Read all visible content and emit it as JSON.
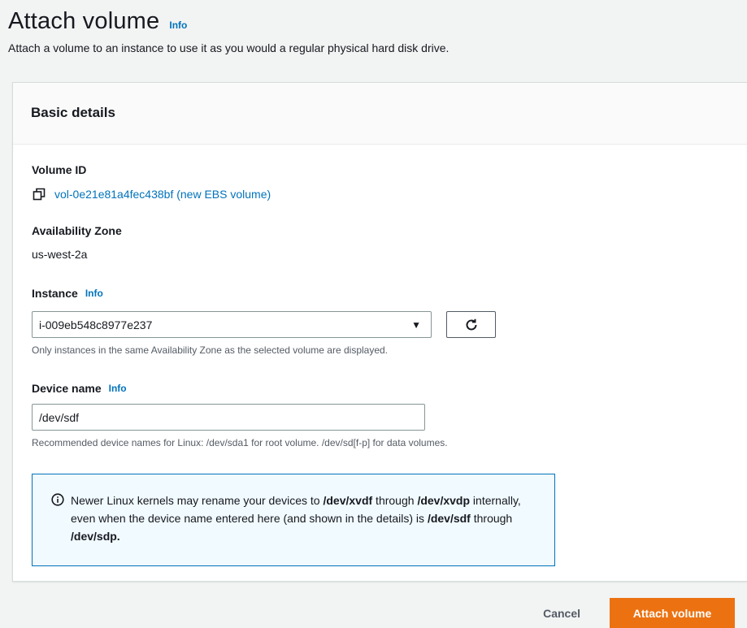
{
  "header": {
    "title": "Attach volume",
    "info": "Info",
    "subtitle": "Attach a volume to an instance to use it as you would a regular physical hard disk drive."
  },
  "panel": {
    "title": "Basic details",
    "volume_id": {
      "label": "Volume ID",
      "value": "vol-0e21e81a4fec438bf (new EBS volume)",
      "icon": "copy-icon"
    },
    "availability_zone": {
      "label": "Availability Zone",
      "value": "us-west-2a"
    },
    "instance": {
      "label": "Instance",
      "info": "Info",
      "selected": "i-009eb548c8977e237",
      "hint": "Only instances in the same Availability Zone as the selected volume are displayed."
    },
    "device_name": {
      "label": "Device name",
      "info": "Info",
      "value": "/dev/sdf",
      "hint": "Recommended device names for Linux: /dev/sda1 for root volume. /dev/sd[f-p] for data volumes."
    },
    "alert": {
      "icon": "info-circle-icon",
      "text_1": "Newer Linux kernels may rename your devices to ",
      "bold_1": "/dev/xvdf",
      "text_2": " through ",
      "bold_2": "/dev/xvdp",
      "text_3": " internally, even when the device name entered here (and shown in the details) is ",
      "bold_3": "/dev/sdf",
      "text_4": " through ",
      "bold_4": "/dev/sdp."
    }
  },
  "footer": {
    "cancel": "Cancel",
    "attach": "Attach volume"
  },
  "colors": {
    "link": "#0073bb",
    "primary": "#ec7211",
    "alert_bg": "#f1faff"
  }
}
